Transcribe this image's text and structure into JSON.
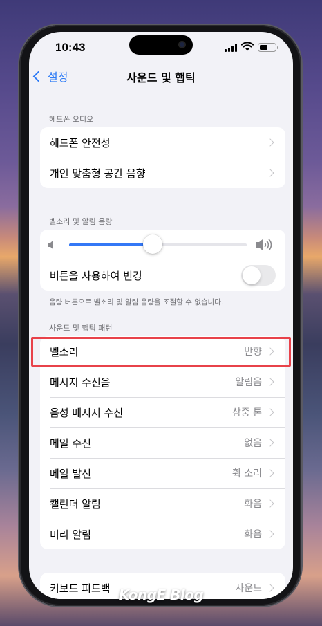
{
  "status": {
    "time": "10:43"
  },
  "nav": {
    "back_label": "설정",
    "title": "사운드 및 햅틱"
  },
  "headphone_audio": {
    "header": "헤드폰 오디오",
    "items": [
      {
        "label": "헤드폰 안전성"
      },
      {
        "label": "개인 맞춤형 공간 음향"
      }
    ]
  },
  "ringer_volume": {
    "header": "벨소리 및 알림 음량",
    "volume_level_fraction": 0.47,
    "change_with_buttons": {
      "label": "버튼을 사용하여 변경",
      "on": false
    },
    "footer": "음량 버튼으로 벨소리 및 알림 음량을 조절할 수 없습니다."
  },
  "patterns": {
    "header": "사운드 및 햅틱 패턴",
    "items": [
      {
        "label": "벨소리",
        "value": "반향"
      },
      {
        "label": "메시지 수신음",
        "value": "알림음"
      },
      {
        "label": "음성 메시지 수신",
        "value": "삼중 톤"
      },
      {
        "label": "메일 수신",
        "value": "없음"
      },
      {
        "label": "메일 발신",
        "value": "휙 소리"
      },
      {
        "label": "캘린더 알림",
        "value": "화음"
      },
      {
        "label": "미리 알림",
        "value": "화음"
      }
    ]
  },
  "keyboard": {
    "label": "키보드 피드백",
    "value": "사운드"
  },
  "colors": {
    "accent": "#3478f6",
    "highlight": "#e8424a"
  },
  "watermark": "KongE Blog"
}
